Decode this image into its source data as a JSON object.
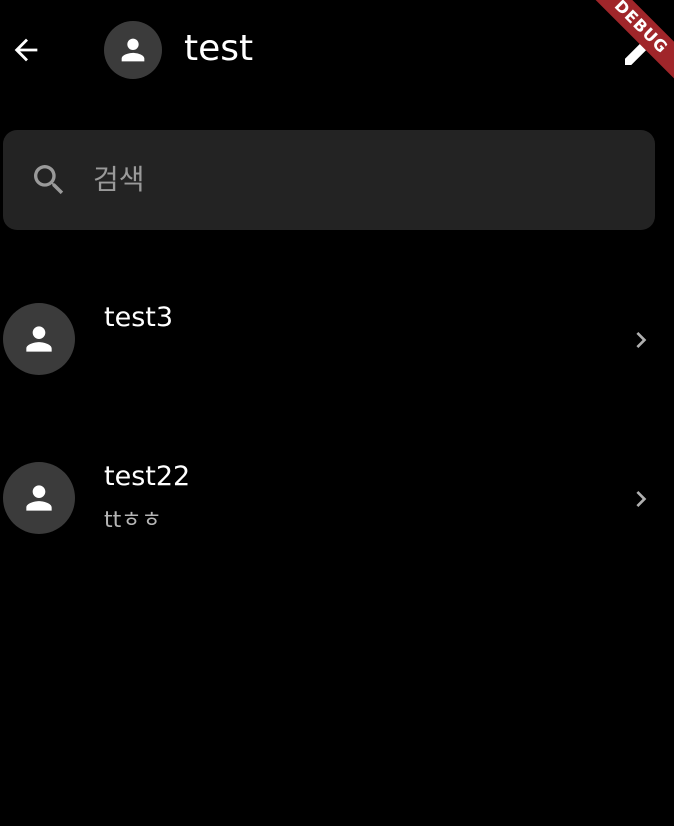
{
  "appbar": {
    "title": "test",
    "back_icon": "arrow-back-icon",
    "avatar_icon": "person-icon",
    "edit_icon": "edit-pencil-icon"
  },
  "debug_banner": {
    "label": "DEBUG"
  },
  "search": {
    "placeholder": "검색",
    "icon": "search-icon"
  },
  "list": {
    "items": [
      {
        "title": "test3",
        "subtitle": "",
        "avatar_icon": "person-icon",
        "trailing_icon": "chevron-right-icon"
      },
      {
        "title": "test22",
        "subtitle": "ttㅎㅎ",
        "avatar_icon": "person-icon",
        "trailing_icon": "chevron-right-icon"
      }
    ]
  },
  "colors": {
    "background": "#000000",
    "search_fill": "#232323",
    "avatar_fill": "#3b3b3b",
    "debug_ribbon": "#a0262a"
  }
}
